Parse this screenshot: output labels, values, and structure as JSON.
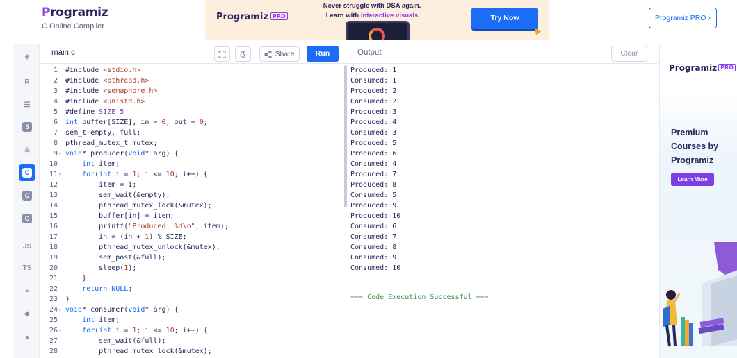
{
  "header": {
    "brand_logo_lead": "P",
    "brand_logo_rest": "rogramiz",
    "brand_subtitle": "C Online Compiler",
    "pro_button": "Programiz PRO ›"
  },
  "ad_banner": {
    "logo": "Programiz",
    "logo_badge": "PRO",
    "line1": "Never struggle with DSA again.",
    "line2_prefix": "Learn with ",
    "line2_highlight": "interactive visuals",
    "cta": "Try Now"
  },
  "rail": {
    "items": [
      {
        "name": "python-icon",
        "glyph": "⚘"
      },
      {
        "name": "r-icon",
        "glyph": "R"
      },
      {
        "name": "sql-icon",
        "glyph": "☰"
      },
      {
        "name": "html-icon",
        "glyph": "5"
      },
      {
        "name": "java-icon",
        "glyph": "♨"
      },
      {
        "name": "c-icon",
        "glyph": "C"
      },
      {
        "name": "cpp-icon",
        "glyph": "C"
      },
      {
        "name": "csharp-icon",
        "glyph": "C"
      },
      {
        "name": "js-icon",
        "glyph": "JS"
      },
      {
        "name": "ts-icon",
        "glyph": "TS"
      },
      {
        "name": "go-icon",
        "glyph": "≡"
      },
      {
        "name": "php-icon",
        "glyph": "◆"
      },
      {
        "name": "swift-icon",
        "glyph": "▲"
      }
    ]
  },
  "editor": {
    "file_tab": "main.c",
    "share_label": "Share",
    "run_label": "Run",
    "lines": [
      {
        "n": "1",
        "fold": "",
        "html": "#include <span class=\"str\">&lt;stdio.h&gt;</span>"
      },
      {
        "n": "2",
        "fold": "",
        "html": "#include <span class=\"str\">&lt;pthread.h&gt;</span>"
      },
      {
        "n": "3",
        "fold": "",
        "html": "#include <span class=\"str\">&lt;semaphore.h&gt;</span>"
      },
      {
        "n": "4",
        "fold": "",
        "html": "#include <span class=\"str\">&lt;unistd.h&gt;</span>"
      },
      {
        "n": "5",
        "fold": "",
        "html": "#define <span class=\"def\">SIZE 5</span>"
      },
      {
        "n": "6",
        "fold": "",
        "html": "<span class=\"kw\">int</span> buffer[SIZE], in = <span class=\"num\">0</span>, out = <span class=\"num\">0</span>;"
      },
      {
        "n": "7",
        "fold": "",
        "html": "sem_t empty, full;"
      },
      {
        "n": "8",
        "fold": "",
        "html": "pthread_mutex_t mutex;"
      },
      {
        "n": "9",
        "fold": "-",
        "html": "<span class=\"kw\">void</span>* producer(<span class=\"kw\">void</span>* arg) {"
      },
      {
        "n": "10",
        "fold": "",
        "html": "    <span class=\"kw\">int</span> item;"
      },
      {
        "n": "11",
        "fold": "-",
        "html": "    <span class=\"kw\">for</span>(<span class=\"kw\">int</span> i = <span class=\"num\">1</span>; i &lt;= <span class=\"num\">10</span>; i++) {"
      },
      {
        "n": "12",
        "fold": "",
        "html": "        item = i;"
      },
      {
        "n": "13",
        "fold": "",
        "html": "        sem_wait(&amp;empty);"
      },
      {
        "n": "14",
        "fold": "",
        "html": "        pthread_mutex_lock(&amp;mutex);"
      },
      {
        "n": "15",
        "fold": "",
        "html": "        buffer[in] = item;"
      },
      {
        "n": "16",
        "fold": "",
        "html": "        printf(<span class=\"str\">\"Produced: %d\\n\"</span>, item);"
      },
      {
        "n": "17",
        "fold": "",
        "html": "        in = (in + <span class=\"num\">1</span>) % SIZE;"
      },
      {
        "n": "18",
        "fold": "",
        "html": "        pthread_mutex_unlock(&amp;mutex);"
      },
      {
        "n": "19",
        "fold": "",
        "html": "        sem_post(&amp;full);"
      },
      {
        "n": "20",
        "fold": "",
        "html": "        sleep(<span class=\"num\">1</span>);"
      },
      {
        "n": "21",
        "fold": "",
        "html": "    }"
      },
      {
        "n": "22",
        "fold": "",
        "html": "    <span class=\"kw\">return</span> <span class=\"kw\">NULL</span>;"
      },
      {
        "n": "23",
        "fold": "",
        "html": "}"
      },
      {
        "n": "24",
        "fold": "-",
        "html": "<span class=\"kw\">void</span>* consumer(<span class=\"kw\">void</span>* arg) {"
      },
      {
        "n": "25",
        "fold": "",
        "html": "    <span class=\"kw\">int</span> item;"
      },
      {
        "n": "26",
        "fold": "-",
        "html": "    <span class=\"kw\">for</span>(<span class=\"kw\">int</span> i = <span class=\"num\">1</span>; i &lt;= <span class=\"num\">10</span>; i++) {"
      },
      {
        "n": "27",
        "fold": "",
        "html": "        sem_wait(&amp;full);"
      },
      {
        "n": "28",
        "fold": "",
        "html": "        pthread_mutex_lock(&amp;mutex);"
      }
    ]
  },
  "output": {
    "title": "Output",
    "clear_label": "Clear",
    "lines": [
      "Produced: 1",
      "Consumed: 1",
      "Produced: 2",
      "Consumed: 2",
      "Produced: 3",
      "Produced: 4",
      "Consumed: 3",
      "Produced: 5",
      "Produced: 6",
      "Consumed: 4",
      "Produced: 7",
      "Produced: 8",
      "Consumed: 5",
      "Produced: 9",
      "Produced: 10",
      "Consumed: 6",
      "Consumed: 7",
      "Consumed: 8",
      "Consumed: 9",
      "Consumed: 10"
    ],
    "success": "=== Code Execution Successful ==="
  },
  "side_ad": {
    "logo": "Programiz",
    "logo_badge": "PRO",
    "text": "Premium Courses by Programiz",
    "cta": "Learn More"
  }
}
